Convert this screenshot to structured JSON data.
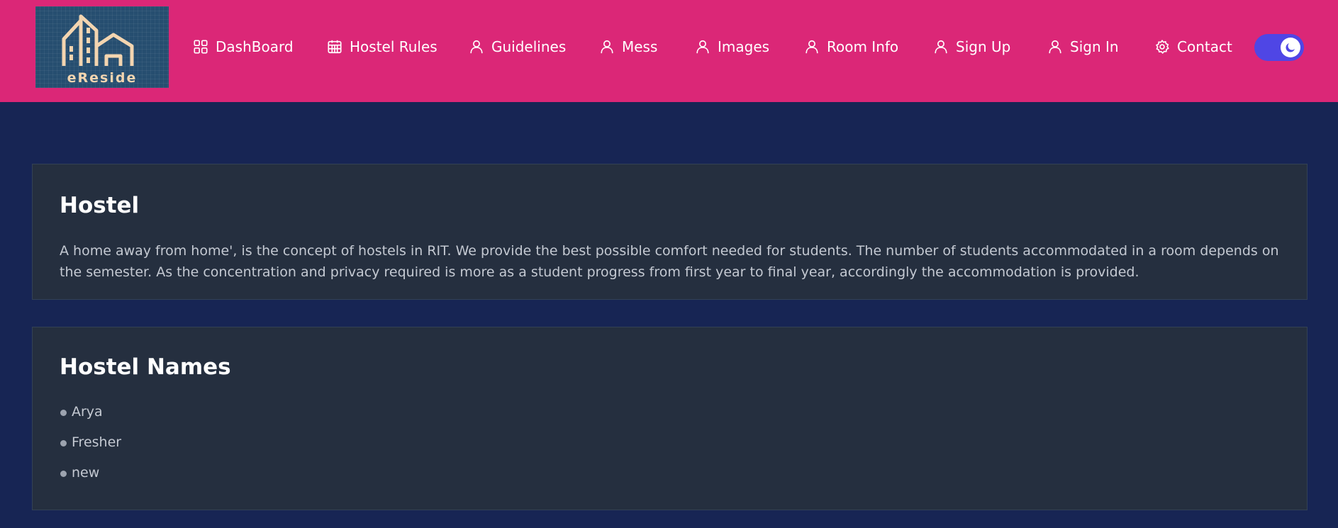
{
  "brand": {
    "name": "eReside"
  },
  "nav": {
    "items": [
      {
        "label": "DashBoard",
        "icon": "dashboard-grid-icon"
      },
      {
        "label": "Hostel Rules",
        "icon": "calendar-icon"
      },
      {
        "label": "Guidelines",
        "icon": "user-icon"
      },
      {
        "label": "Mess",
        "icon": "user-icon"
      },
      {
        "label": "Images",
        "icon": "user-icon"
      },
      {
        "label": "Room Info",
        "icon": "user-icon"
      },
      {
        "label": "Sign Up",
        "icon": "user-icon"
      },
      {
        "label": "Sign In",
        "icon": "user-icon"
      },
      {
        "label": "Contact",
        "icon": "gear-icon"
      }
    ],
    "theme_toggle": {
      "state": "dark",
      "icon": "moon-icon"
    }
  },
  "colors": {
    "header": "#db2777",
    "background": "#172554",
    "card": "#252f3f",
    "toggle": "#4f46e5"
  },
  "main": {
    "about": {
      "title": "Hostel",
      "description": "A home away from home', is the concept of hostels in RIT. We provide the best possible comfort needed for students. The number of students accommodated in a room depends on the semester. As the concentration and privacy required is more as a student progress from first year to final year, accordingly the accommodation is provided."
    },
    "hostels": {
      "title": "Hostel Names",
      "names": [
        "Arya",
        "Fresher",
        "new"
      ]
    }
  }
}
